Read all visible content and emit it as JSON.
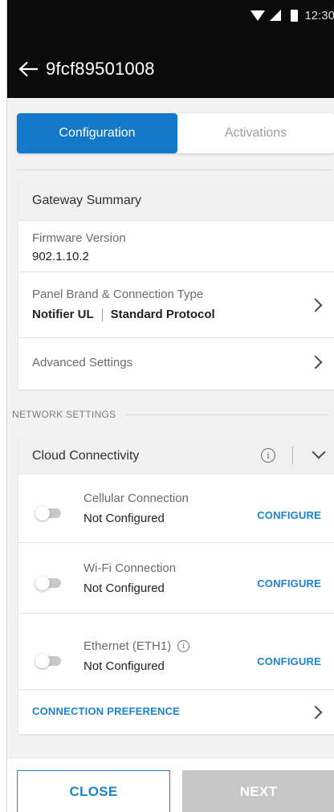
{
  "status_bar": {
    "time": "12:30",
    "icons": [
      "wifi-icon",
      "signal-icon",
      "battery-icon"
    ]
  },
  "app_bar": {
    "title": "9fcf89501008",
    "back_icon": "arrow-left-icon"
  },
  "tabs": [
    {
      "label": "Configuration",
      "active": true
    },
    {
      "label": "Activations",
      "active": false
    }
  ],
  "gateway_summary": {
    "header": "Gateway Summary",
    "firmware": {
      "label": "Firmware Version",
      "value": "902.1.10.2"
    },
    "panel": {
      "label": "Panel Brand & Connection Type",
      "brand": "Notifier UL",
      "connection": "Standard Protocol"
    },
    "advanced": {
      "label": "Advanced Settings"
    }
  },
  "network_settings": {
    "heading": "NETWORK SETTINGS",
    "cloud": {
      "header": "Cloud Connectivity",
      "info_symbol": "i",
      "connections": [
        {
          "label": "Cellular Connection",
          "status": "Not Configured",
          "action": "CONFIGURE",
          "enabled": false
        },
        {
          "label": "Wi-Fi Connection",
          "status": "Not Configured",
          "action": "CONFIGURE",
          "enabled": false
        },
        {
          "label": "Ethernet (ETH1)",
          "status": "Not Configured",
          "action": "CONFIGURE",
          "enabled": false
        }
      ],
      "preference_label": "CONNECTION PREFERENCE"
    }
  },
  "footer": {
    "close_label": "CLOSE",
    "next_label": "NEXT"
  },
  "colors": {
    "accent": "#1378c8",
    "link": "#1c84cf",
    "disabled": "#c6c6c6",
    "app_bar": "#0b0b0b"
  }
}
